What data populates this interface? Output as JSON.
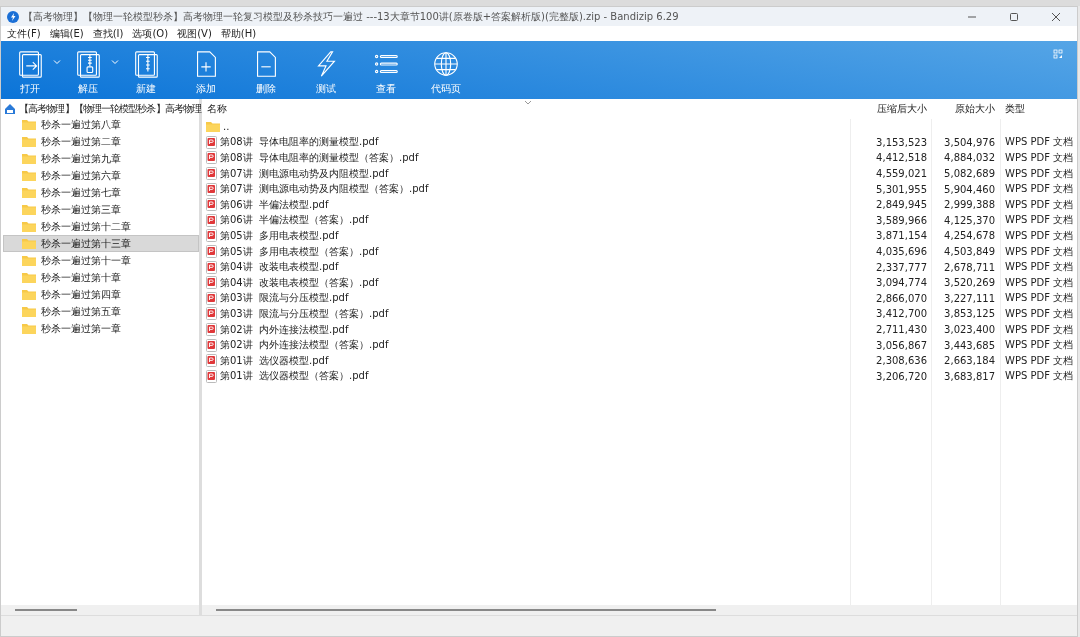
{
  "window": {
    "title": "【高考物理】【物理一轮模型秒杀】高考物理一轮复习模型及秒杀技巧一遍过 ---13大章节100讲(原卷版+答案解析版)(完整版).zip - Bandizip 6.29"
  },
  "menu": [
    "文件(F)",
    "编辑(E)",
    "查找(I)",
    "选项(O)",
    "视图(V)",
    "帮助(H)"
  ],
  "toolbar": [
    {
      "label": "打开",
      "kind": "open",
      "dropdown": true
    },
    {
      "label": "解压",
      "kind": "extract",
      "dropdown": true
    },
    {
      "label": "新建",
      "kind": "new",
      "dropdown": false
    },
    {
      "label": "添加",
      "kind": "add",
      "dropdown": false
    },
    {
      "label": "删除",
      "kind": "delete",
      "dropdown": false
    },
    {
      "label": "测试",
      "kind": "test",
      "dropdown": false
    },
    {
      "label": "查看",
      "kind": "view",
      "dropdown": false
    },
    {
      "label": "代码页",
      "kind": "codepage",
      "dropdown": false
    }
  ],
  "tree": {
    "root": "【高考物理】【物理一轮模型秒杀】高考物理",
    "children": [
      {
        "label": "秒杀一遍过第八章",
        "selected": false
      },
      {
        "label": "秒杀一遍过第二章",
        "selected": false
      },
      {
        "label": "秒杀一遍过第九章",
        "selected": false
      },
      {
        "label": "秒杀一遍过第六章",
        "selected": false
      },
      {
        "label": "秒杀一遍过第七章",
        "selected": false
      },
      {
        "label": "秒杀一遍过第三章",
        "selected": false
      },
      {
        "label": "秒杀一遍过第十二章",
        "selected": false
      },
      {
        "label": "秒杀一遍过第十三章",
        "selected": true
      },
      {
        "label": "秒杀一遍过第十一章",
        "selected": false
      },
      {
        "label": "秒杀一遍过第十章",
        "selected": false
      },
      {
        "label": "秒杀一遍过第四章",
        "selected": false
      },
      {
        "label": "秒杀一遍过第五章",
        "selected": false
      },
      {
        "label": "秒杀一遍过第一章",
        "selected": false
      }
    ]
  },
  "table": {
    "columns": [
      "名称",
      "压缩后大小",
      "原始大小",
      "类型"
    ],
    "rows": [
      {
        "kind": "folder",
        "name": ".."
      },
      {
        "kind": "pdf",
        "name": "第08讲  导体电阻率的测量模型.pdf",
        "packed": "3,153,523",
        "size": "3,504,976",
        "type": "WPS PDF 文档"
      },
      {
        "kind": "pdf",
        "name": "第08讲  导体电阻率的测量模型（答案）.pdf",
        "packed": "4,412,518",
        "size": "4,884,032",
        "type": "WPS PDF 文档"
      },
      {
        "kind": "pdf",
        "name": "第07讲  测电源电动势及内阻模型.pdf",
        "packed": "4,559,021",
        "size": "5,082,689",
        "type": "WPS PDF 文档"
      },
      {
        "kind": "pdf",
        "name": "第07讲  测电源电动势及内阻模型（答案）.pdf",
        "packed": "5,301,955",
        "size": "5,904,460",
        "type": "WPS PDF 文档"
      },
      {
        "kind": "pdf",
        "name": "第06讲  半偏法模型.pdf",
        "packed": "2,849,945",
        "size": "2,999,388",
        "type": "WPS PDF 文档"
      },
      {
        "kind": "pdf",
        "name": "第06讲  半偏法模型（答案）.pdf",
        "packed": "3,589,966",
        "size": "4,125,370",
        "type": "WPS PDF 文档"
      },
      {
        "kind": "pdf",
        "name": "第05讲  多用电表模型.pdf",
        "packed": "3,871,154",
        "size": "4,254,678",
        "type": "WPS PDF 文档"
      },
      {
        "kind": "pdf",
        "name": "第05讲  多用电表模型（答案）.pdf",
        "packed": "4,035,696",
        "size": "4,503,849",
        "type": "WPS PDF 文档"
      },
      {
        "kind": "pdf",
        "name": "第04讲  改装电表模型.pdf",
        "packed": "2,337,777",
        "size": "2,678,711",
        "type": "WPS PDF 文档"
      },
      {
        "kind": "pdf",
        "name": "第04讲  改装电表模型（答案）.pdf",
        "packed": "3,094,774",
        "size": "3,520,269",
        "type": "WPS PDF 文档"
      },
      {
        "kind": "pdf",
        "name": "第03讲  限流与分压模型.pdf",
        "packed": "2,866,070",
        "size": "3,227,111",
        "type": "WPS PDF 文档"
      },
      {
        "kind": "pdf",
        "name": "第03讲  限流与分压模型（答案）.pdf",
        "packed": "3,412,700",
        "size": "3,853,125",
        "type": "WPS PDF 文档"
      },
      {
        "kind": "pdf",
        "name": "第02讲  内外连接法模型.pdf",
        "packed": "2,711,430",
        "size": "3,023,400",
        "type": "WPS PDF 文档"
      },
      {
        "kind": "pdf",
        "name": "第02讲  内外连接法模型（答案）.pdf",
        "packed": "3,056,867",
        "size": "3,443,685",
        "type": "WPS PDF 文档"
      },
      {
        "kind": "pdf",
        "name": "第01讲  选仪器模型.pdf",
        "packed": "2,308,636",
        "size": "2,663,184",
        "type": "WPS PDF 文档"
      },
      {
        "kind": "pdf",
        "name": "第01讲  选仪器模型（答案）.pdf",
        "packed": "3,206,720",
        "size": "3,683,817",
        "type": "WPS PDF 文档"
      }
    ]
  }
}
